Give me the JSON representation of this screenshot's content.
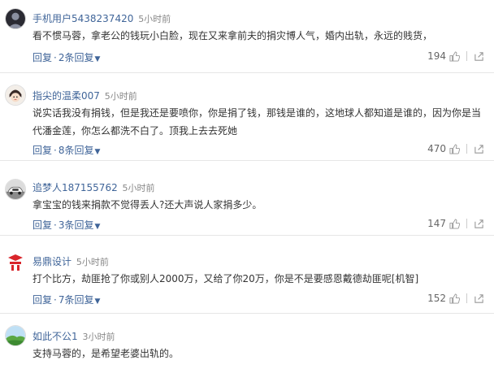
{
  "comments": [
    {
      "user": "手机用户5438237420",
      "time": "5小时前",
      "text": "看不惯马蓉，拿老公的钱玩小白脸，现在又来拿前夫的捐灾博人气，婚内出轨，永远的贱货，",
      "reply_label": "回复",
      "replies_label": "2条回复",
      "likes": "194",
      "avatar_icon": "default-user-avatar-icon"
    },
    {
      "user": "指尖的温柔007",
      "time": "5小时前",
      "text": "说实话我没有捐钱，但是我还是要喷你，你是捐了钱，那钱是谁的，这地球人都知道是谁的，因为你是当代潘金莲，你怎么都洗不白了。顶我上去去死她",
      "reply_label": "回复",
      "replies_label": "8条回复",
      "likes": "470",
      "avatar_icon": "cartoon-face-avatar-icon"
    },
    {
      "user": "追梦人187155762",
      "time": "5小时前",
      "text": "拿宝宝的钱来捐款不觉得丢人?还大声说人家捐多少。",
      "reply_label": "回复",
      "replies_label": "3条回复",
      "likes": "147",
      "avatar_icon": "car-avatar-icon"
    },
    {
      "user": "易鼎设计",
      "time": "5小时前",
      "text": "打个比方，劫匪抢了你或别人2000万，又给了你20万，你是不是要感恩戴德劫匪呢[机智]",
      "reply_label": "回复",
      "replies_label": "7条回复",
      "likes": "152",
      "avatar_icon": "red-logo-avatar-icon"
    },
    {
      "user": "如此不公1",
      "time": "3小时前",
      "text": "支持马蓉的，是希望老婆出轨的。",
      "avatar_icon": "landscape-avatar-icon"
    }
  ],
  "colors": {
    "username": "#406599",
    "action_link": "#406599",
    "meta": "#888888"
  }
}
